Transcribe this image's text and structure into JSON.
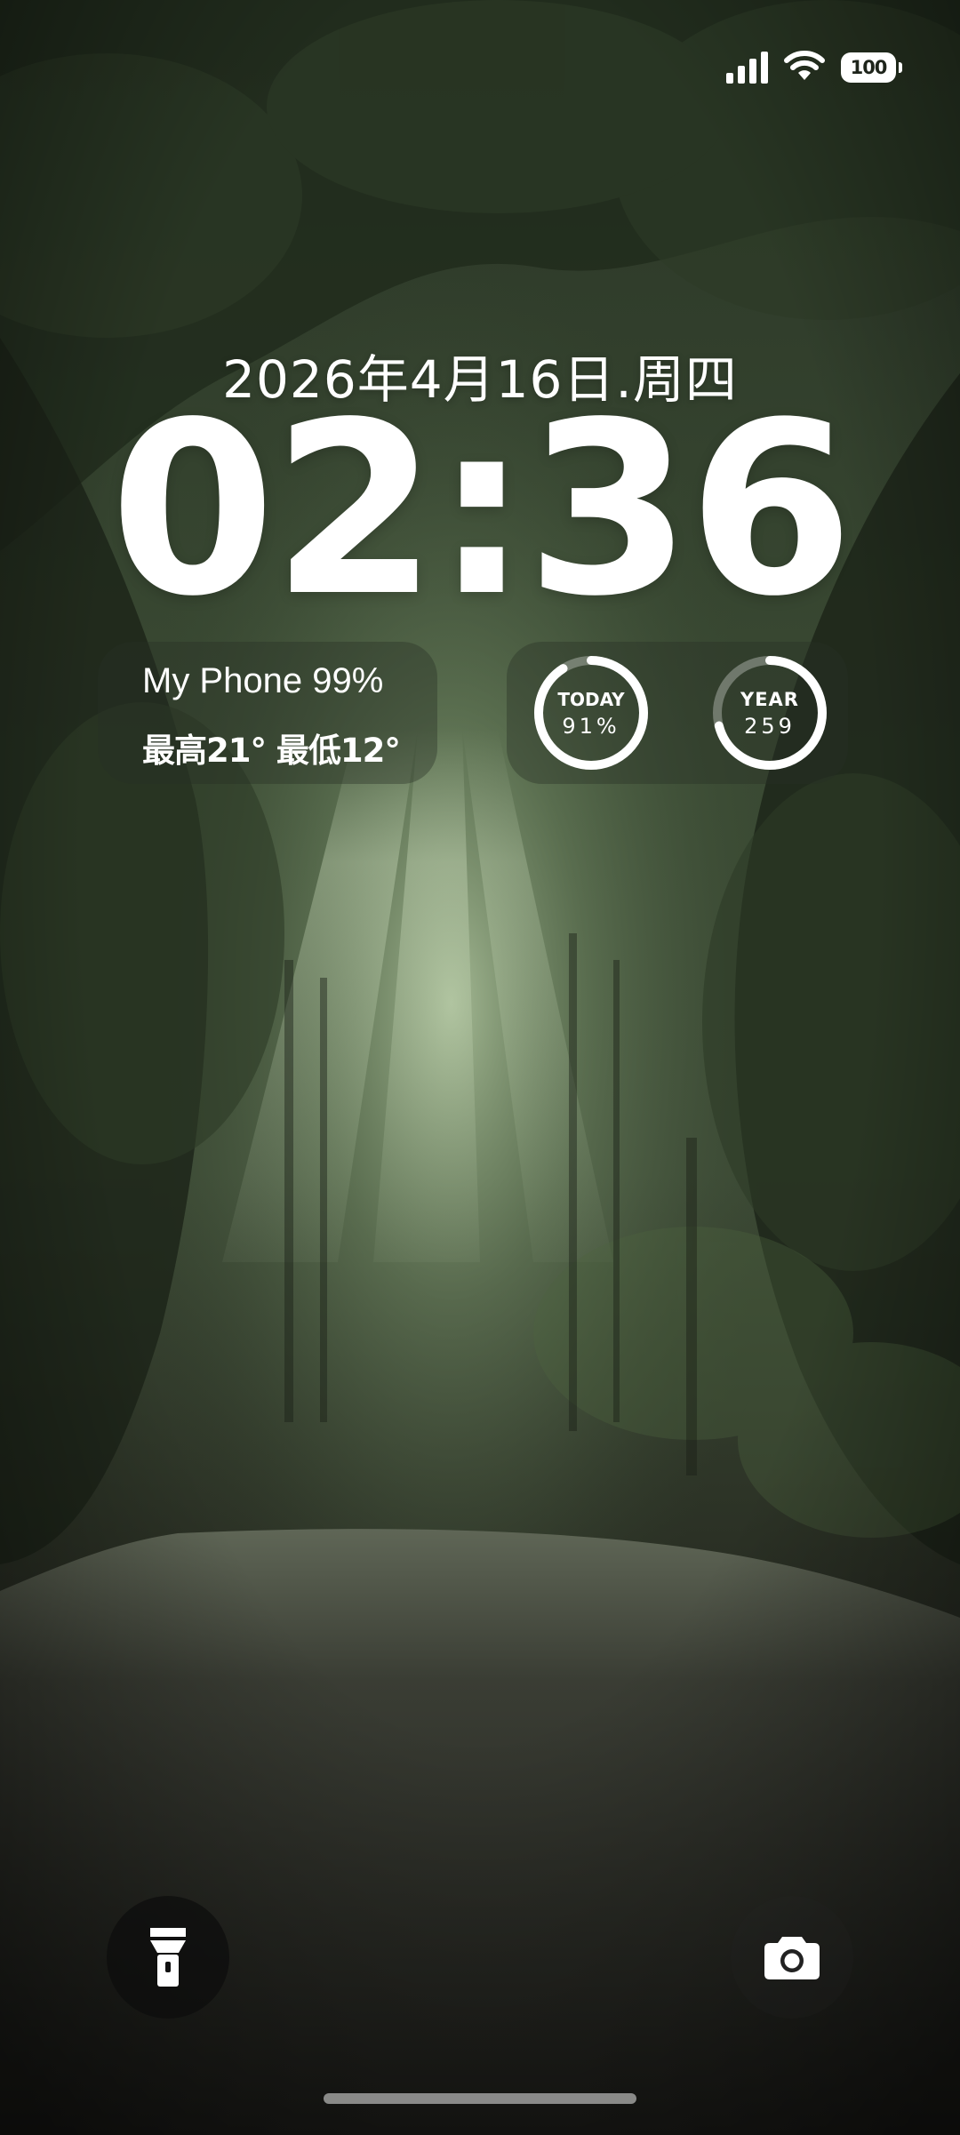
{
  "status_bar": {
    "signal_icon": "cellular-signal-icon",
    "wifi_icon": "wifi-icon",
    "battery_level": "100"
  },
  "lock_screen": {
    "date": "2026年4月16日.周四",
    "time": "02:36"
  },
  "widget_info": {
    "device_battery": "My Phone 99%",
    "weather_range": "最高21° 最低12°"
  },
  "widget_progress": {
    "today": {
      "label": "TODAY",
      "value": "91%",
      "progress": 0.91
    },
    "year": {
      "label": "YEAR",
      "value": "259",
      "progress": 0.71
    }
  },
  "controls": {
    "flashlight_icon": "flashlight-icon",
    "camera_icon": "camera-icon"
  },
  "colors": {
    "text": "#ffffff",
    "widget_bg": "rgba(40,48,36,0.38)",
    "ring_track": "rgba(255,255,255,0.3)",
    "ring_fill": "#ffffff"
  }
}
